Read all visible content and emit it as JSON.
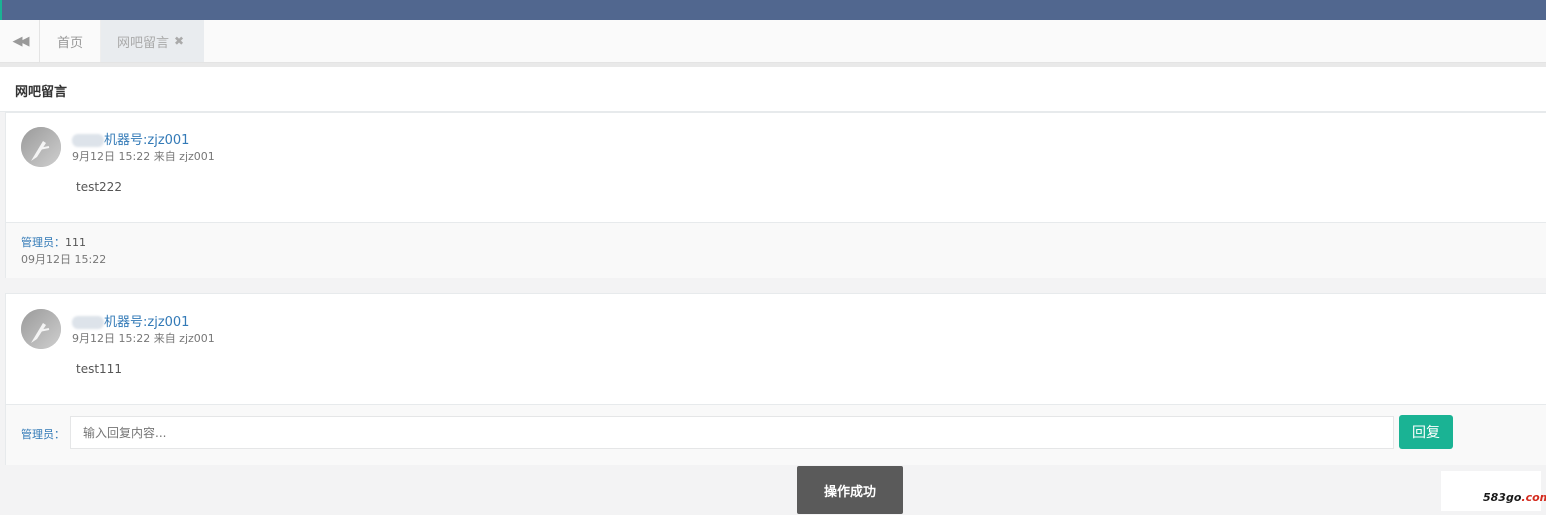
{
  "tabs": {
    "back_icon": "double-left-arrow",
    "home_label": "首页",
    "active_label": "网吧留言",
    "close_icon": "close-x"
  },
  "panel": {
    "title": "网吧留言"
  },
  "messages": [
    {
      "sender": "机器号:zjz001",
      "meta": "9月12日 15:22 来自 zjz001",
      "text": "test222",
      "reply": {
        "admin_label": "管理员：",
        "text": "111",
        "time": "09月12日 15:22"
      }
    },
    {
      "sender": "机器号:zjz001",
      "meta": "9月12日 15:22 来自 zjz001",
      "text": "test111",
      "reply_form": {
        "admin_label": "管理员：",
        "placeholder": "输入回复内容...",
        "button": "回复"
      }
    }
  ],
  "toast": "操作成功",
  "watermark": {
    "brand": "583go",
    "suffix": ".com"
  },
  "colors": {
    "topbar": "#51678f",
    "accent": "#1ab394",
    "link": "#337ab7"
  }
}
